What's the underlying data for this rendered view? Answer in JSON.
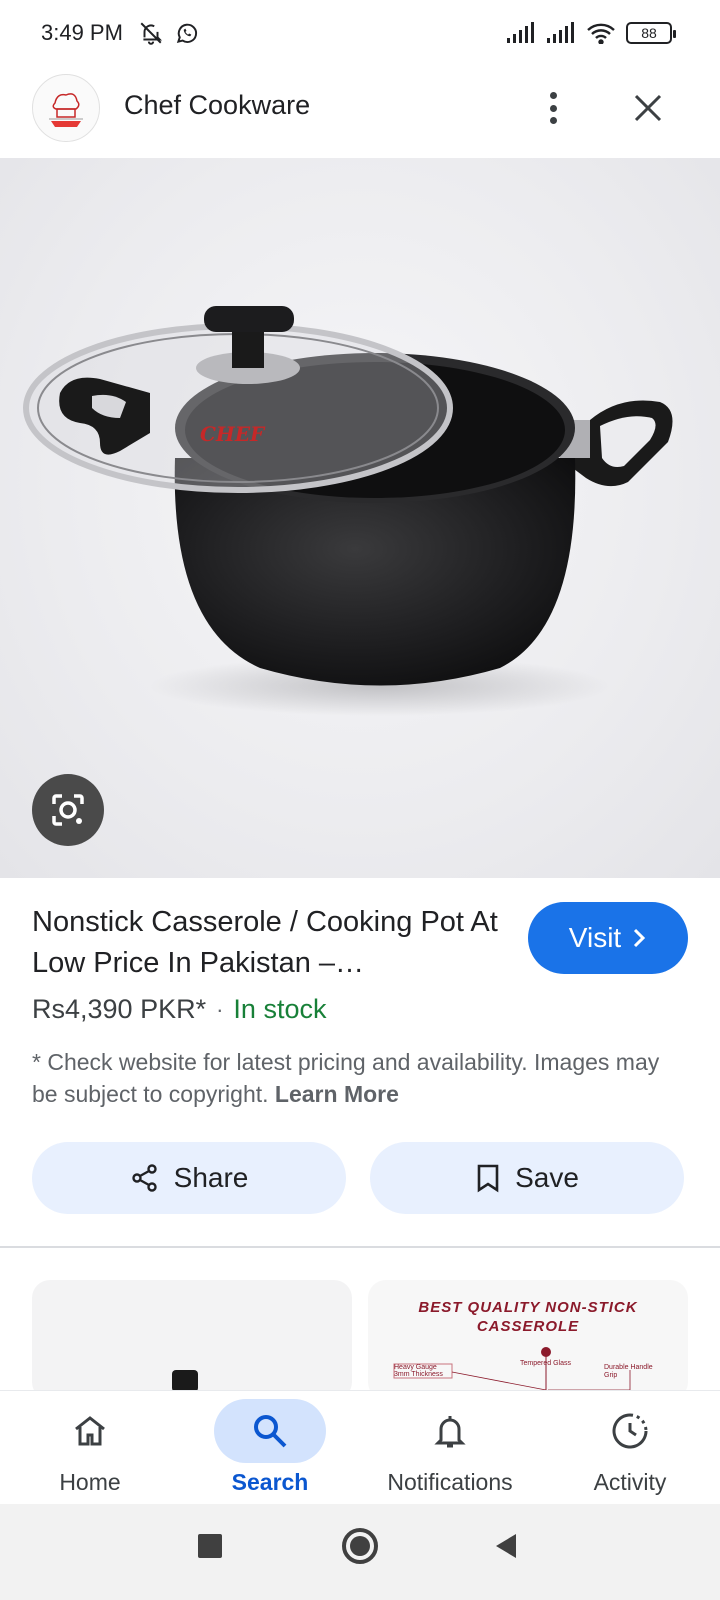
{
  "status_bar": {
    "time": "3:49 PM",
    "battery": "88"
  },
  "header": {
    "site_name": "Chef Cookware",
    "logo_icon": "chef-logo-icon"
  },
  "hero": {
    "image_alt": "product-image-icon",
    "lens_icon": "google-lens-icon"
  },
  "product": {
    "title": "Nonstick Casserole / Cooking Pot At Low Price In Pakistan –…",
    "price": "Rs4,390 PKR*",
    "separator": "·",
    "stock": "In stock",
    "disclaimer": "* Check website for latest pricing and availability. Images may be subject to copyright.",
    "learn_more": "Learn More",
    "visit_label": "Visit"
  },
  "actions": {
    "share_label": "Share",
    "save_label": "Save"
  },
  "related": {
    "right_thumb_title": "Best Quality Non-Stick Casserole",
    "right_thumb_notes": [
      "Heavy Gauge 3mm Thickness",
      "Tempered Glass",
      "Durable Handle Grip"
    ]
  },
  "bottom_nav": {
    "items": [
      {
        "label": "Home",
        "icon": "home-icon"
      },
      {
        "label": "Search",
        "icon": "search-icon"
      },
      {
        "label": "Notifications",
        "icon": "bell-icon"
      },
      {
        "label": "Activity",
        "icon": "activity-icon"
      }
    ],
    "active": "Search"
  },
  "colors": {
    "accent": "#1a73e8",
    "stock_green": "#188038",
    "pill_bg": "#e8f0fe",
    "nav_active_bg": "#d3e3fd"
  }
}
